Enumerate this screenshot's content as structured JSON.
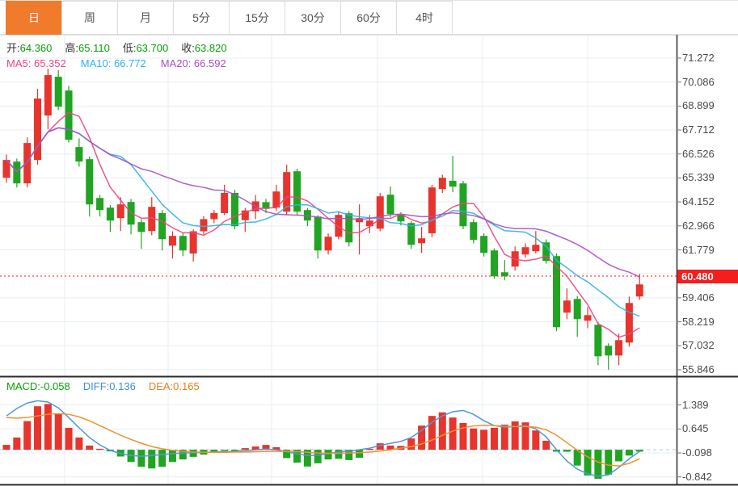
{
  "toolbar": {
    "tabs": [
      {
        "label": "日",
        "active": true
      },
      {
        "label": "周",
        "active": false
      },
      {
        "label": "月",
        "active": false
      },
      {
        "label": "5分",
        "active": false
      },
      {
        "label": "15分",
        "active": false
      },
      {
        "label": "30分",
        "active": false
      },
      {
        "label": "60分",
        "active": false
      },
      {
        "label": "4时",
        "active": false
      }
    ]
  },
  "ohlc": {
    "open_label": "开:",
    "open": "64.360",
    "high_label": "高:",
    "high": "65.110",
    "low_label": "低:",
    "low": "63.700",
    "close_label": "收:",
    "close": "63.820"
  },
  "ma_header": {
    "ma5_label": "MA5:",
    "ma5": "65.352",
    "ma10_label": "MA10:",
    "ma10": "66.772",
    "ma20_label": "MA20:",
    "ma20": "66.592"
  },
  "macd_header": {
    "macd_label": "MACD:",
    "macd": "-0.058",
    "diff_label": "DIFF:",
    "diff": "0.136",
    "dea_label": "DEA:",
    "dea": "0.165"
  },
  "price_line": {
    "value": 60.48,
    "label": "60.480"
  },
  "colors": {
    "up": "#e7342c",
    "down": "#21a421",
    "accent_tab": "#f07b2c",
    "ohlc_value": "#08a008",
    "ma5": "#ef437f",
    "ma10": "#2fb2e5",
    "ma20": "#a94fc0",
    "diff_line": "#4f97dd",
    "dea_line": "#f29130",
    "macd_text": "#08a008",
    "diff_text": "#3e8ede",
    "dea_text": "#f07c1a",
    "grid": "#e7eef6",
    "axis": "#2b2b2b",
    "tick": "#777777",
    "price_dotted": "#ff4438",
    "badge": "#f51d1d",
    "zero_dash": "#b5d7f2"
  },
  "chart_data": [
    {
      "type": "candlestick",
      "title": "daily K-line main panel",
      "legend": [
        "MA5",
        "MA10",
        "MA20"
      ],
      "ma_periods": [
        5,
        10,
        20
      ],
      "axis_ticks": [
        "71.272",
        "70.086",
        "68.899",
        "67.712",
        "66.526",
        "65.339",
        "64.152",
        "62.966",
        "61.779",
        "59.406",
        "58.219",
        "57.032",
        "55.846"
      ],
      "tick_values": [
        71.272,
        70.086,
        68.899,
        67.712,
        66.526,
        65.339,
        64.152,
        62.966,
        61.779,
        59.406,
        58.219,
        57.032,
        55.846
      ],
      "ylim": [
        55.846,
        71.272
      ],
      "tick_step": 1.1866,
      "grid": true,
      "price_line": 60.48,
      "candles_format": [
        "open",
        "high",
        "low",
        "close"
      ],
      "candles": [
        [
          65.35,
          66.5,
          65.1,
          66.23
        ],
        [
          66.15,
          66.3,
          64.87,
          65.07
        ],
        [
          65.07,
          67.35,
          64.87,
          67.07
        ],
        [
          66.23,
          69.75,
          66.0,
          69.27
        ],
        [
          68.43,
          70.75,
          67.75,
          70.43
        ],
        [
          70.35,
          70.67,
          68.7,
          68.87
        ],
        [
          69.67,
          69.9,
          67.1,
          67.23
        ],
        [
          66.87,
          67.3,
          65.9,
          66.15
        ],
        [
          66.27,
          66.4,
          63.43,
          64.03
        ],
        [
          64.35,
          64.5,
          63.43,
          63.75
        ],
        [
          63.87,
          64.0,
          62.67,
          63.23
        ],
        [
          63.35,
          64.39,
          62.71,
          64.03
        ],
        [
          64.15,
          64.3,
          62.55,
          63.03
        ],
        [
          63.15,
          63.3,
          61.83,
          62.67
        ],
        [
          62.71,
          64.39,
          62.5,
          63.91
        ],
        [
          63.6,
          63.75,
          61.75,
          62.31
        ],
        [
          61.99,
          62.7,
          61.35,
          62.47
        ],
        [
          62.47,
          62.6,
          61.47,
          61.75
        ],
        [
          61.6,
          62.8,
          61.2,
          62.7
        ],
        [
          62.7,
          63.45,
          62.55,
          63.3
        ],
        [
          63.3,
          63.75,
          63.1,
          63.6
        ],
        [
          63.6,
          65.0,
          63.5,
          64.6
        ],
        [
          64.6,
          64.75,
          62.8,
          62.95
        ],
        [
          63.25,
          63.85,
          62.67,
          63.73
        ],
        [
          63.69,
          64.5,
          63.3,
          64.18
        ],
        [
          64.14,
          64.3,
          63.6,
          63.81
        ],
        [
          63.87,
          65.0,
          63.7,
          64.67
        ],
        [
          63.67,
          66.0,
          63.5,
          65.63
        ],
        [
          65.67,
          65.8,
          63.5,
          63.67
        ],
        [
          63.75,
          63.85,
          62.95,
          63.23
        ],
        [
          63.43,
          63.5,
          61.35,
          61.75
        ],
        [
          61.75,
          62.6,
          61.55,
          62.43
        ],
        [
          62.43,
          63.7,
          62.3,
          63.51
        ],
        [
          63.59,
          63.7,
          61.95,
          62.15
        ],
        [
          63.15,
          64.03,
          61.55,
          63.35
        ],
        [
          62.95,
          63.5,
          62.6,
          63.23
        ],
        [
          62.83,
          64.6,
          62.7,
          64.43
        ],
        [
          64.51,
          64.91,
          63.4,
          63.55
        ],
        [
          63.51,
          63.65,
          62.99,
          63.19
        ],
        [
          63.11,
          63.2,
          61.83,
          62.03
        ],
        [
          62.11,
          62.91,
          61.63,
          62.35
        ],
        [
          62.6,
          65.0,
          62.4,
          64.87
        ],
        [
          64.79,
          65.5,
          64.6,
          65.35
        ],
        [
          65.2,
          66.43,
          64.63,
          64.91
        ],
        [
          65.07,
          65.2,
          62.8,
          62.95
        ],
        [
          63.15,
          63.3,
          62.1,
          62.27
        ],
        [
          62.47,
          62.6,
          61.45,
          61.63
        ],
        [
          61.75,
          61.85,
          60.35,
          60.47
        ],
        [
          60.67,
          61.27,
          60.27,
          60.47
        ],
        [
          60.95,
          61.95,
          60.75,
          61.71
        ],
        [
          61.55,
          62.1,
          61.4,
          61.91
        ],
        [
          61.71,
          62.71,
          61.6,
          62.03
        ],
        [
          62.15,
          62.3,
          61.1,
          61.23
        ],
        [
          61.47,
          61.6,
          57.75,
          57.95
        ],
        [
          58.67,
          59.87,
          58.35,
          59.27
        ],
        [
          59.35,
          59.5,
          57.47,
          58.35
        ],
        [
          58.27,
          58.95,
          57.9,
          58.55
        ],
        [
          58.07,
          58.2,
          56.07,
          56.51
        ],
        [
          57.03,
          57.15,
          55.85,
          56.55
        ],
        [
          56.55,
          57.63,
          56.07,
          57.31
        ],
        [
          57.19,
          59.47,
          56.99,
          59.15
        ],
        [
          59.47,
          60.59,
          59.31,
          60.07
        ]
      ]
    },
    {
      "type": "bar",
      "title": "MACD sub panel",
      "legend": [
        "MACD",
        "DIFF",
        "DEA"
      ],
      "axis_ticks": [
        "1.389",
        "0.645",
        "-0.098",
        "-0.842"
      ],
      "tick_values": [
        1.389,
        0.645,
        -0.098,
        -0.842
      ],
      "ylim": [
        -1.07,
        2.2
      ],
      "grid": true,
      "histogram": [
        0.15,
        0.38,
        0.89,
        1.35,
        1.42,
        1.11,
        0.68,
        0.38,
        0.13,
        0.03,
        -0.05,
        -0.21,
        -0.38,
        -0.53,
        -0.58,
        -0.53,
        -0.38,
        -0.3,
        -0.22,
        -0.15,
        -0.08,
        -0.03,
        -0.02,
        0.05,
        0.1,
        0.15,
        0.08,
        -0.26,
        -0.4,
        -0.52,
        -0.42,
        -0.3,
        -0.28,
        -0.32,
        -0.25,
        0.03,
        0.2,
        0.13,
        0.12,
        0.35,
        0.75,
        1.05,
        1.16,
        1.0,
        0.83,
        0.66,
        0.62,
        0.68,
        0.78,
        0.88,
        0.85,
        0.6,
        0.28,
        -0.06,
        -0.06,
        -0.49,
        -0.8,
        -0.9,
        -0.77,
        -0.36,
        -0.18,
        -0.058
      ],
      "series": [
        {
          "name": "DIFF",
          "values": [
            1.05,
            1.28,
            1.45,
            1.52,
            1.48,
            1.3,
            1.0,
            0.68,
            0.38,
            0.15,
            -0.02,
            -0.12,
            -0.18,
            -0.2,
            -0.18,
            -0.15,
            -0.12,
            -0.1,
            -0.09,
            -0.08,
            -0.07,
            -0.06,
            -0.05,
            -0.03,
            0.0,
            0.02,
            0.0,
            -0.06,
            -0.13,
            -0.18,
            -0.17,
            -0.12,
            -0.07,
            -0.04,
            0.0,
            0.05,
            0.13,
            0.2,
            0.26,
            0.38,
            0.6,
            0.85,
            1.05,
            1.18,
            1.22,
            1.1,
            0.9,
            0.75,
            0.7,
            0.72,
            0.75,
            0.65,
            0.4,
            0.0,
            -0.35,
            -0.6,
            -0.75,
            -0.82,
            -0.78,
            -0.55,
            -0.28,
            -0.05
          ]
        },
        {
          "name": "DEA",
          "values": [
            1.0,
            0.98,
            1.0,
            1.05,
            1.1,
            1.12,
            1.1,
            1.02,
            0.9,
            0.75,
            0.6,
            0.45,
            0.32,
            0.2,
            0.1,
            0.03,
            -0.02,
            -0.05,
            -0.07,
            -0.08,
            -0.08,
            -0.08,
            -0.07,
            -0.07,
            -0.06,
            -0.05,
            -0.05,
            -0.05,
            -0.06,
            -0.08,
            -0.1,
            -0.11,
            -0.11,
            -0.1,
            -0.09,
            -0.07,
            -0.04,
            0.0,
            0.05,
            0.1,
            0.18,
            0.3,
            0.45,
            0.58,
            0.68,
            0.74,
            0.76,
            0.75,
            0.73,
            0.72,
            0.72,
            0.7,
            0.62,
            0.45,
            0.22,
            -0.02,
            -0.22,
            -0.38,
            -0.48,
            -0.5,
            -0.42,
            -0.28
          ]
        }
      ]
    }
  ]
}
